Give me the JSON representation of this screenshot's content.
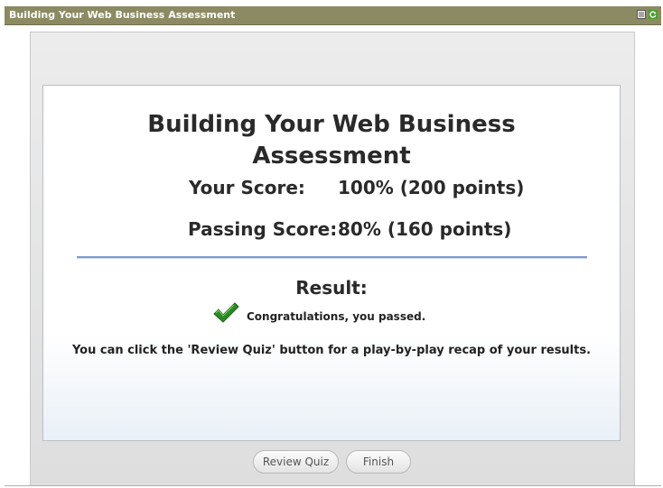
{
  "window": {
    "title": "Building Your Web Business Assessment"
  },
  "result": {
    "heading_line1": "Building Your Web Business",
    "heading_line2": "Assessment",
    "your_score_label": "Your Score:",
    "your_score_value": "100% (200 points)",
    "passing_score_label": "Passing Score:",
    "passing_score_value": "80% (160 points)",
    "result_label": "Result:",
    "status_message": "Congratulations, you passed.",
    "hint": "You can click the 'Review Quiz' button for a play-by-play recap of your results."
  },
  "buttons": {
    "review": "Review Quiz",
    "finish": "Finish"
  },
  "icons": {
    "status": "checkmark-icon",
    "titlebar": [
      "notes-icon",
      "refresh-icon"
    ]
  },
  "colors": {
    "titlebar": "#8b8a62",
    "check": "#2c8a25",
    "divider": "#7f9ccc"
  }
}
